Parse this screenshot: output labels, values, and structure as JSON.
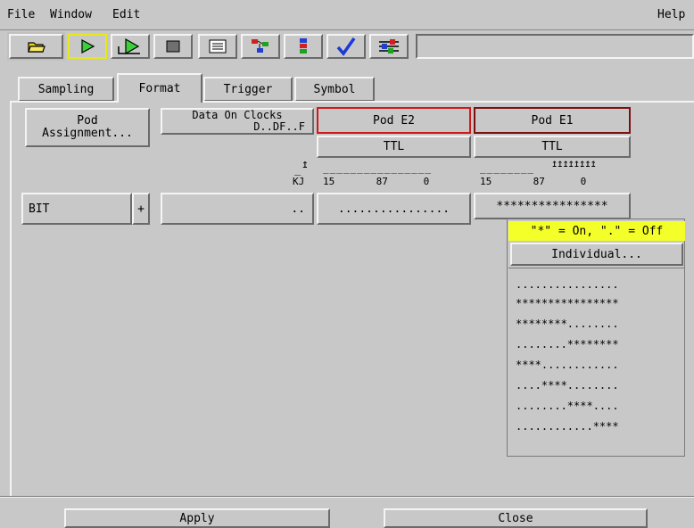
{
  "menubar": {
    "file": "File",
    "window": "Window",
    "edit": "Edit",
    "help": "Help"
  },
  "toolbar": {
    "icons": [
      "open-folder-icon",
      "run-icon",
      "run-repetitive-icon",
      "stop-icon",
      "listing-icon",
      "overview-icon",
      "system-icon",
      "check-icon",
      "setup-icon"
    ],
    "search_value": ""
  },
  "tabs": [
    {
      "label": "Sampling"
    },
    {
      "label": "Format",
      "active": true
    },
    {
      "label": "Trigger"
    },
    {
      "label": "Symbol"
    }
  ],
  "format": {
    "pod_assignment_line1": "Pod",
    "pod_assignment_line2": "Assignment...",
    "data_on_clocks_line1": "Data On Clocks",
    "data_on_clocks_line2": "D..DF..F",
    "pod_e2": "Pod E2",
    "pod_e1": "Pod E1",
    "threshold_e2": "TTL",
    "threshold_e1": "TTL",
    "clk_label": "KJ",
    "e2_bits": "15       87      0",
    "e1_bits": "15       87      0",
    "e2_dashes": "________________",
    "e1_dashes": "________",
    "e1_arrows": "↥↥↥↥↥↥↥↥",
    "clk_arrow": "↥"
  },
  "label_row": {
    "name": "BIT",
    "plus": "+",
    "clocks_value": "..",
    "e2_value": "................",
    "e1_value": "****************"
  },
  "popup": {
    "legend": "\"*\" = On, \".\" = Off",
    "individual": "Individual...",
    "items": [
      "................",
      "****************",
      "********........",
      "........********",
      "****............",
      "....****........",
      "........****....",
      "............****"
    ]
  },
  "bottom": {
    "apply": "Apply",
    "close": "Close"
  },
  "colors": {
    "background": "#c8c8c8",
    "pod_e2_border": "#d01818",
    "pod_e1_border": "#7a1010",
    "legend_bg": "#f4ff2a"
  }
}
